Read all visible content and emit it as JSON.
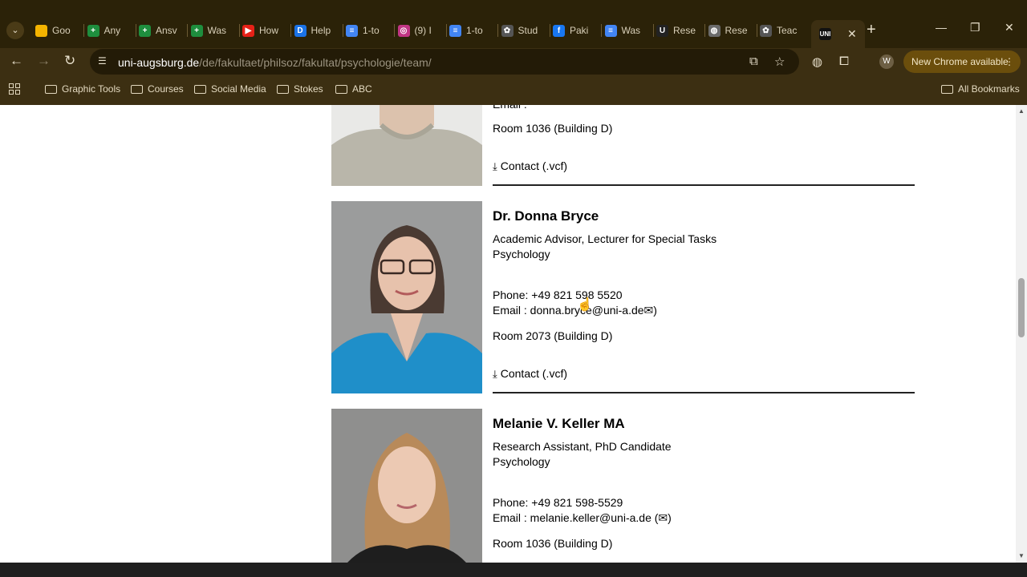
{
  "browser": {
    "tabs": [
      {
        "label": "Goo",
        "favicon": "google-keep-icon",
        "color": "#f4b400"
      },
      {
        "label": "Any",
        "favicon": "sheets-icon",
        "color": "#1e8e3e"
      },
      {
        "label": "Ansv",
        "favicon": "sheets-icon",
        "color": "#1e8e3e"
      },
      {
        "label": "Was",
        "favicon": "sheets-icon",
        "color": "#1e8e3e"
      },
      {
        "label": "How",
        "favicon": "youtube-icon",
        "color": "#e62117"
      },
      {
        "label": "Help",
        "favicon": "d-icon",
        "color": "#1a73e8"
      },
      {
        "label": "1-to",
        "favicon": "docs-icon",
        "color": "#4285f4"
      },
      {
        "label": "(9) I",
        "favicon": "instagram-icon",
        "color": "#c13584"
      },
      {
        "label": "1-to",
        "favicon": "docs-icon",
        "color": "#4285f4"
      },
      {
        "label": "Stud",
        "favicon": "chatgpt-icon",
        "color": "#555555"
      },
      {
        "label": "Paki",
        "favicon": "facebook-icon",
        "color": "#1877f2"
      },
      {
        "label": "Was",
        "favicon": "docs-icon",
        "color": "#4285f4"
      },
      {
        "label": "Rese",
        "favicon": "uni-icon",
        "color": "#222222"
      },
      {
        "label": "Rese",
        "favicon": "globe-icon",
        "color": "#6b6b6b"
      },
      {
        "label": "Teac",
        "favicon": "chatgpt-icon",
        "color": "#555555"
      }
    ],
    "active_tab_favicon": "UNI",
    "url_host": "uni-augsburg.de",
    "url_path": "/de/fakultaet/philsoz/fakultat/psychologie/team/",
    "update_label": "New Chrome available",
    "avatar_letter": "W",
    "bookmarks": [
      "Graphic Tools",
      "Courses",
      "Social Media",
      "Stokes",
      "ABC"
    ],
    "all_bookmarks": "All Bookmarks"
  },
  "people": [
    {
      "email_partial": "Email : ",
      "room": "Room 1036 (Building D)",
      "contact": "Contact (.vcf)"
    },
    {
      "name": "Dr. Donna Bryce",
      "role": "Academic Advisor, Lecturer for Special Tasks",
      "dept": "Psychology",
      "phone": "Phone: +49 821 598 5520",
      "email": "Email : donna.bryce@uni-a.de",
      "email_icon": "✉",
      "room": "Room 2073 (Building D)",
      "contact": "Contact (.vcf)"
    },
    {
      "name": "Melanie V. Keller MA",
      "role": "Research Assistant, PhD Candidate",
      "dept": "Psychology",
      "phone": "Phone: +49 821 598-5529",
      "email": "Email : melanie.keller@uni-a.de (",
      "email_icon": "✉",
      "email_close": ")",
      "room": "Room 1036 (Building D)"
    }
  ]
}
